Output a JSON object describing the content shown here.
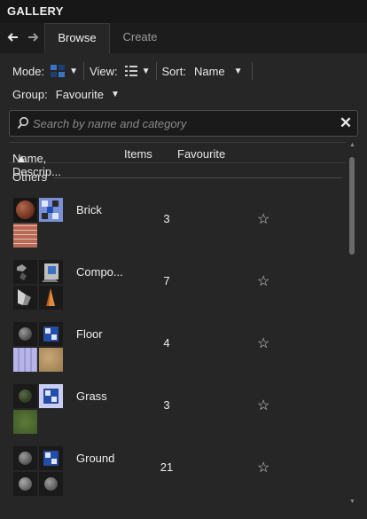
{
  "window": {
    "title": "GALLERY"
  },
  "nav": {
    "back_glyph": "🡐",
    "forward_glyph": "🡒"
  },
  "tabs": [
    {
      "label": "Browse",
      "active": true
    },
    {
      "label": "Create",
      "active": false
    }
  ],
  "toolbar": {
    "mode_label": "Mode:",
    "view_label": "View:",
    "sort_label": "Sort:",
    "sort_value": "Name",
    "group_label": "Group:",
    "group_value": "Favourite",
    "dropdown_glyph": "▼"
  },
  "search": {
    "placeholder": "Search by name and category",
    "value": "",
    "clear_glyph": "✕"
  },
  "columns": {
    "name": "Name, Descrip...",
    "items": "Items",
    "favourite": "Favourite",
    "sort_glyph": "▲"
  },
  "group": {
    "label": "Others"
  },
  "list": [
    {
      "name": "Brick",
      "count": "3",
      "favourite": false,
      "star": "☆"
    },
    {
      "name": "Compo...",
      "count": "7",
      "favourite": false,
      "star": "☆"
    },
    {
      "name": "Floor",
      "count": "4",
      "favourite": false,
      "star": "☆"
    },
    {
      "name": "Grass",
      "count": "3",
      "favourite": false,
      "star": "☆"
    },
    {
      "name": "Ground",
      "count": "21",
      "favourite": false,
      "star": "☆"
    }
  ],
  "icons": {
    "back": "arrow-left-icon",
    "forward": "arrow-right-icon",
    "mode": "grid-mode-icon",
    "view": "list-view-icon",
    "search": "magnifier-icon",
    "clear": "close-icon",
    "favourite": "star-outline-icon"
  },
  "colors": {
    "panel": "#262626",
    "titlebar": "#171717",
    "accent_blue": "#3a72c4"
  }
}
